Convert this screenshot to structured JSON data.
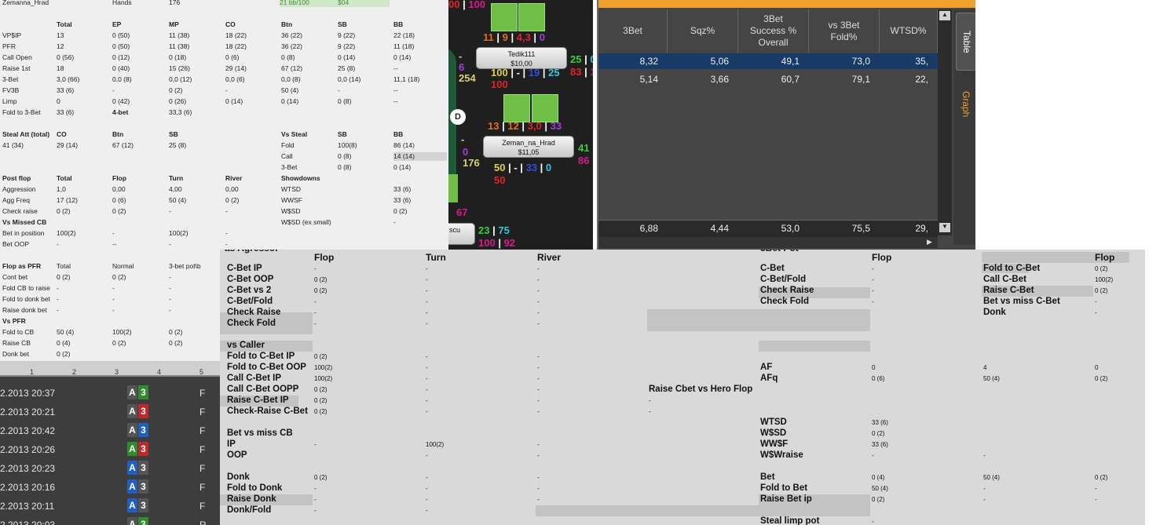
{
  "left_stats": {
    "top": {
      "player": "Zemanna_Hrad",
      "hands_label": "Hands",
      "hands": "176",
      "bb": "21 bb/100",
      "money": "$04"
    },
    "pre": {
      "headers": [
        "Total",
        "EP",
        "MP",
        "CO",
        "Btn",
        "SB",
        "BB"
      ],
      "rows": [
        {
          "label": "VP$IP",
          "vals": [
            "13",
            "0 (50)",
            "11 (38)",
            "18 (22)",
            "36 (22)",
            "9 (22)",
            "22 (18)"
          ]
        },
        {
          "label": "PFR",
          "vals": [
            "12",
            "0 (50)",
            "11 (38)",
            "18 (22)",
            "36 (22)",
            "9 (22)",
            "11 (18)"
          ]
        },
        {
          "label": "Call Open",
          "vals": [
            "0 (56)",
            "0 (12)",
            "0 (18)",
            "0 (6)",
            "0 (8)",
            "0 (14)",
            "0 (14)"
          ]
        },
        {
          "label": "Raise 1st",
          "vals": [
            "18",
            "0 (40)",
            "15 (26)",
            "29 (14)",
            "67 (12)",
            "25 (8)",
            "--"
          ]
        },
        {
          "label": "3-Bet",
          "vals": [
            "3,0 (66)",
            "0,0 (8)",
            "0,0 (12)",
            "0,0 (6)",
            "0,0 (8)",
            "0,0 (14)",
            "11,1 (18)"
          ]
        },
        {
          "label": "FV3B",
          "vals": [
            "33 (6)",
            "-",
            "0 (2)",
            "-",
            "50 (4)",
            "-",
            "--"
          ]
        },
        {
          "label": "Limp",
          "vals": [
            "0",
            "0 (42)",
            "0 (26)",
            "0 (14)",
            "0 (14)",
            "0 (8)",
            "--"
          ]
        },
        {
          "label": "Fold to 3-Bet",
          "vals": [
            "33 (6)",
            "4-bet",
            "33,3 (6)",
            "",
            "",
            "",
            ""
          ]
        }
      ]
    },
    "steal": {
      "h_left": [
        "Steal Att (total)",
        "CO",
        "Btn",
        "SB"
      ],
      "v_left": [
        "41 (34)",
        "29 (14)",
        "67 (12)",
        "25 (8)"
      ],
      "h_right": [
        "Vs Steal",
        "SB",
        "BB"
      ],
      "rows_right": [
        [
          "Fold",
          "100(8)",
          "86 (14)"
        ],
        [
          "Call",
          "0 (8)",
          "14 (14)"
        ],
        [
          "3-Bet",
          "0 (8)",
          "0 (14)"
        ]
      ]
    },
    "post": {
      "headers": [
        "Post flop",
        "Total",
        "Flop",
        "Turn",
        "River",
        "Showdowns"
      ],
      "rows": [
        {
          "label": "Aggression",
          "vals": [
            "1,0",
            "0,00",
            "4,00",
            "0,00"
          ],
          "sd": "WTSD",
          "sdv": "33 (6)"
        },
        {
          "label": "Agg Freq",
          "vals": [
            "17 (12)",
            "0 (6)",
            "50 (4)",
            "0 (2)"
          ],
          "sd": "WWSF",
          "sdv": "33 (6)"
        },
        {
          "label": "Check raise",
          "vals": [
            "0 (2)",
            "0 (2)",
            "-",
            "-"
          ],
          "sd": "W$SD",
          "sdv": "0 (2)"
        },
        {
          "label": "Vs Missed CB",
          "vals": [
            "",
            "",
            "",
            ""
          ],
          "sd": "W$SD (ex small)",
          "sdv": "-"
        },
        {
          "label": "Bet in position",
          "vals": [
            "100(2)",
            "-",
            "100(2)",
            "-"
          ],
          "sd": "",
          "sdv": ""
        },
        {
          "label": "Bet OOP",
          "vals": [
            "-",
            "--",
            "-",
            "-"
          ],
          "sd": "",
          "sdv": ""
        }
      ]
    },
    "pfr": {
      "headers": [
        "Flop as PFR",
        "Total",
        "Normal",
        "3-bet pot\\b"
      ],
      "rows": [
        {
          "label": "Cont bet",
          "vals": [
            "0 (2)",
            "0 (2)",
            "-"
          ]
        },
        {
          "label": "Fold CB to raise",
          "vals": [
            "-",
            "-",
            "-"
          ]
        },
        {
          "label": "Fold to donk bet",
          "vals": [
            "-",
            "-",
            "-"
          ]
        },
        {
          "label": "Raise donk bet",
          "vals": [
            "-",
            "-",
            "-"
          ]
        },
        {
          "label": "Vs PFR",
          "vals": [
            "",
            "",
            ""
          ]
        },
        {
          "label": "Fold to CB",
          "vals": [
            "50 (4)",
            "100(2)",
            "0 (2)"
          ]
        },
        {
          "label": "Raise CB",
          "vals": [
            "0 (4)",
            "0 (2)",
            "0 (2)"
          ]
        },
        {
          "label": "Donk bet",
          "vals": [
            "0 (2)",
            "",
            ""
          ]
        }
      ]
    }
  },
  "hands_list": {
    "cols": [
      "1",
      "2",
      "3",
      "4",
      "5"
    ],
    "rows": [
      {
        "date": "2.2013 20:37",
        "c1": "A",
        "c2": "3",
        "res": "F",
        "col1": "#555555",
        "col2": "#2e8b2e"
      },
      {
        "date": "2.2013 20:21",
        "c1": "A",
        "c2": "3",
        "res": "F",
        "col1": "#555555",
        "col2": "#c0262a"
      },
      {
        "date": "2.2013 20:42",
        "c1": "A",
        "c2": "3",
        "res": "F",
        "col1": "#555555",
        "col2": "#1f5fc0"
      },
      {
        "date": "2.2013 20:26",
        "c1": "A",
        "c2": "3",
        "res": "F",
        "col1": "#2e8b2e",
        "col2": "#c0262a"
      },
      {
        "date": "2.2013 20:23",
        "c1": "A",
        "c2": "3",
        "res": "F",
        "col1": "#1f5fc0",
        "col2": "#555555"
      },
      {
        "date": "2.2013 20:16",
        "c1": "A",
        "c2": "3",
        "res": "F",
        "col1": "#1f5fc0",
        "col2": "#555555"
      },
      {
        "date": "2.2013 20:11",
        "c1": "A",
        "c2": "3",
        "res": "F",
        "col1": "#1f5fc0",
        "col2": "#555555"
      },
      {
        "date": "2.2013 20:03",
        "c1": "A",
        "c2": "3",
        "res": "R",
        "col1": "#555555",
        "col2": "#2e8b2e"
      }
    ]
  },
  "poker_table": {
    "top_line": [
      {
        "t": "00",
        "c": "#e0242a"
      },
      {
        "t": " | ",
        "c": "#ffffff"
      },
      {
        "t": "100",
        "c": "#d21d8a"
      }
    ],
    "p1": {
      "name": "Tedik111",
      "stack": "$10,00",
      "hud_top": [
        {
          "t": "11",
          "c": "#e07020"
        },
        {
          "t": " | ",
          "c": "#fff"
        },
        {
          "t": "9",
          "c": "#e07020"
        },
        {
          "t": " | ",
          "c": "#fff"
        },
        {
          "t": "4,3",
          "c": "#e0242a"
        },
        {
          "t": " | ",
          "c": "#fff"
        },
        {
          "t": "0",
          "c": "#a040d0"
        }
      ],
      "left": [
        {
          "t": "-",
          "c": "#cccccc"
        },
        {
          "t": "6",
          "c": "#a040d0"
        },
        {
          "t": "254",
          "c": "#d8d070"
        }
      ],
      "right": [
        {
          "t": "25",
          "c": "#3dcc3d"
        },
        {
          "t": " | ",
          "c": "#fff"
        },
        {
          "t": "0",
          "c": "#30c8e0"
        }
      ],
      "bottom": [
        {
          "t": "100",
          "c": "#e0d040"
        },
        {
          "t": " | ",
          "c": "#fff"
        },
        {
          "t": "-",
          "c": "#fff"
        },
        {
          "t": " | ",
          "c": "#fff"
        },
        {
          "t": "19",
          "c": "#3050e0"
        },
        {
          "t": " | ",
          "c": "#fff"
        },
        {
          "t": "25",
          "c": "#30c8e0"
        }
      ],
      "bottom_right": [
        {
          "t": "83",
          "c": "#e0242a"
        },
        {
          "t": " | ",
          "c": "#fff"
        },
        {
          "t": "100",
          "c": "#d21d8a"
        }
      ],
      "bottom2": [
        {
          "t": "100",
          "c": "#e0242a"
        }
      ]
    },
    "p2": {
      "name": "Zeman_na_Hrad",
      "stack": "$11,05",
      "hud_top": [
        {
          "t": "13",
          "c": "#e07020"
        },
        {
          "t": " | ",
          "c": "#fff"
        },
        {
          "t": "12",
          "c": "#e07020"
        },
        {
          "t": " | ",
          "c": "#fff"
        },
        {
          "t": "3,0",
          "c": "#e0242a"
        },
        {
          "t": " | ",
          "c": "#fff"
        },
        {
          "t": "33",
          "c": "#a040d0"
        }
      ],
      "left": [
        {
          "t": "-",
          "c": "#cccccc"
        },
        {
          "t": "0",
          "c": "#a040d0"
        },
        {
          "t": "176",
          "c": "#d8d070"
        }
      ],
      "right": [
        {
          "t": "41",
          "c": "#3dcc3d"
        },
        {
          "t": " | ",
          "c": "#fff"
        },
        {
          "t": "50",
          "c": "#30c8e0"
        }
      ],
      "right2": [
        {
          "t": "86",
          "c": "#d21d8a"
        },
        {
          "t": " | ",
          "c": "#fff"
        },
        {
          "t": "100",
          "c": "#d21d8a"
        }
      ],
      "bottom": [
        {
          "t": "50",
          "c": "#e0d040"
        },
        {
          "t": " | ",
          "c": "#fff"
        },
        {
          "t": "-",
          "c": "#fff"
        },
        {
          "t": " | ",
          "c": "#fff"
        },
        {
          "t": "33",
          "c": "#3050e0"
        },
        {
          "t": " | ",
          "c": "#fff"
        },
        {
          "t": "0",
          "c": "#30c8e0"
        }
      ],
      "bottom2": [
        {
          "t": "50",
          "c": "#e0242a"
        }
      ]
    },
    "p3": {
      "name": "scu",
      "left": [
        {
          "t": "67",
          "c": "#d21d8a"
        }
      ],
      "right": [
        {
          "t": "23",
          "c": "#3dcc3d"
        },
        {
          "t": " | ",
          "c": "#fff"
        },
        {
          "t": "75",
          "c": "#30c8e0"
        }
      ],
      "bottom": [
        {
          "t": "100",
          "c": "#d21d8a"
        },
        {
          "t": " | ",
          "c": "#fff"
        },
        {
          "t": "92",
          "c": "#d21d8a"
        }
      ]
    },
    "dealer": "D"
  },
  "grid": {
    "headers": [
      "3Bet",
      "Sqz%",
      "3Bet\nSuccess %\nOverall",
      "vs 3Bet\nFold%",
      "WTSD%"
    ],
    "rows": [
      [
        "8,32",
        "5,06",
        "49,1",
        "73,0",
        "35,"
      ],
      [
        "5,14",
        "3,66",
        "60,7",
        "79,1",
        "22,"
      ]
    ],
    "footer": [
      "6,88",
      "4,44",
      "53,0",
      "75,5",
      "29,"
    ],
    "tabs": [
      "Table",
      "Graph"
    ]
  },
  "bottom_panel": {
    "titles": {
      "as_agressor": "as Agressor",
      "bet3pot": "3Bet Pot"
    },
    "mid_headers": [
      "Flop",
      "Turn",
      "River"
    ],
    "mid_rows": [
      {
        "label": "C-Bet IP",
        "v": [
          "-",
          "-",
          "-"
        ]
      },
      {
        "label": "C-Bet OOP",
        "v": [
          "0 (2)",
          "-",
          "-"
        ]
      },
      {
        "label": "C-Bet vs 2",
        "v": [
          "0 (2)",
          "-",
          "-"
        ]
      },
      {
        "label": "C-Bet/Fold",
        "v": [
          "-",
          "-",
          "-"
        ]
      },
      {
        "label": "Check Raise",
        "v": [
          "-",
          "-",
          "-"
        ]
      },
      {
        "label": "Check Fold",
        "v": [
          "-",
          "-",
          "-"
        ]
      },
      {
        "label": "",
        "v": [
          "",
          "",
          ""
        ]
      },
      {
        "label": "vs Caller",
        "v": [
          "",
          "",
          ""
        ]
      },
      {
        "label": "Fold to C-Bet IP",
        "v": [
          "0 (2)",
          "-",
          "-"
        ]
      },
      {
        "label": "Fold to C-Bet OOP",
        "v": [
          "100(2)",
          "-",
          "-"
        ]
      },
      {
        "label": "Call C-Bet IP",
        "v": [
          "100(2)",
          "-",
          "-"
        ]
      },
      {
        "label": "Call C-Bet OOPP",
        "v": [
          "0 (2)",
          "-",
          "-"
        ]
      },
      {
        "label": "Raise C-Bet IP",
        "v": [
          "0 (2)",
          "-",
          "-"
        ]
      },
      {
        "label": "Check-Raise C-Bet",
        "v": [
          "0 (2)",
          "-",
          "-"
        ]
      },
      {
        "label": "",
        "v": [
          "",
          "",
          ""
        ]
      },
      {
        "label": "Bet vs miss CB",
        "v": [
          "",
          "",
          ""
        ]
      },
      {
        "label": "IP",
        "v": [
          "-",
          "100(2)",
          "-"
        ]
      },
      {
        "label": "OOP",
        "v": [
          "",
          "-",
          "-"
        ]
      },
      {
        "label": "",
        "v": [
          "",
          "",
          ""
        ]
      },
      {
        "label": "Donk",
        "v": [
          "0 (2)",
          "-",
          "-"
        ]
      },
      {
        "label": "Fold to Donk",
        "v": [
          "-",
          "-",
          "-"
        ]
      },
      {
        "label": "Raise Donk",
        "v": [
          "-",
          "-",
          "-"
        ]
      },
      {
        "label": "Donk/Fold",
        "v": [
          "-",
          "-",
          ""
        ]
      }
    ],
    "raise_cbet": {
      "label": "Raise Cbet vs Hero Flop",
      "v": [
        "-",
        "-"
      ]
    },
    "right_headers": [
      "Flop",
      "Flop"
    ],
    "right_rows_a": [
      {
        "label": "C-Bet",
        "v": "-",
        "label2": "Fold to C-Bet",
        "v2": "0 (2)"
      },
      {
        "label": "C-Bet/Fold",
        "v": "-",
        "label2": "Call C-Bet",
        "v2": "100(2)"
      },
      {
        "label": "Check Raise",
        "v": "-",
        "label2": "Raise C-Bet",
        "v2": "0 (2)"
      },
      {
        "label": "Check Fold",
        "v": "-",
        "label2": "Bet vs miss C-Bet",
        "v2": "-"
      },
      {
        "label": "",
        "v": "",
        "label2": "Donk",
        "v2": "-"
      }
    ],
    "af": [
      {
        "label": "AF",
        "v": [
          "0",
          "4",
          "0"
        ]
      },
      {
        "label": "AFq",
        "v": [
          "0 (6)",
          "50 (4)",
          "0 (2)"
        ]
      }
    ],
    "sd": [
      {
        "label": "WTSD",
        "v": "33 (6)"
      },
      {
        "label": "W$SD",
        "v": "0 (2)"
      },
      {
        "label": "WW$F",
        "v": "33 (6)"
      },
      {
        "label": "W$Wraise",
        "v": "-",
        "v2": "-"
      }
    ],
    "bet": [
      {
        "label": "Bet",
        "v": [
          "0 (4)",
          "50 (4)",
          "0 (2)"
        ]
      },
      {
        "label": "Fold to Bet",
        "v": [
          "50 (4)",
          "-",
          "-"
        ]
      },
      {
        "label": "Raise Bet ip",
        "v": [
          "0 (2)",
          "-",
          "-"
        ]
      }
    ],
    "steal_limp": {
      "label": "Steal limp pot",
      "v": "-"
    }
  }
}
